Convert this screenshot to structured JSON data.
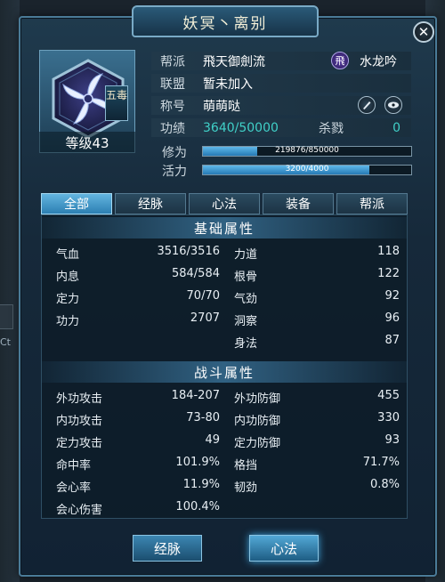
{
  "window": {
    "title": "妖冥丶离别"
  },
  "profile": {
    "school_badge": "五毒",
    "level_text": "等级43",
    "rows": [
      {
        "label": "帮派",
        "value": "飛天御劍流",
        "extra_icon": "飛",
        "extra_value": "水龙吟"
      },
      {
        "label": "联盟",
        "value": "暂未加入"
      },
      {
        "label": "称号",
        "value": "萌萌哒"
      },
      {
        "label": "功绩",
        "value": "3640/50000",
        "label2": "杀戮",
        "value2": "0"
      }
    ],
    "bars": [
      {
        "label": "修为",
        "text": "219876/850000",
        "progress": 0.259
      },
      {
        "label": "活力",
        "text": "3200/4000",
        "progress": 0.8
      }
    ]
  },
  "tabs": [
    {
      "label": "全部",
      "active": true
    },
    {
      "label": "经脉",
      "active": false
    },
    {
      "label": "心法",
      "active": false
    },
    {
      "label": "装备",
      "active": false
    },
    {
      "label": "帮派",
      "active": false
    }
  ],
  "basic": {
    "title": "基础属性",
    "left": [
      {
        "name": "气血",
        "value": "3516/3516"
      },
      {
        "name": "内息",
        "value": "584/584"
      },
      {
        "name": "定力",
        "value": "70/70"
      },
      {
        "name": "功力",
        "value": "2707"
      }
    ],
    "right": [
      {
        "name": "力道",
        "value": "118"
      },
      {
        "name": "根骨",
        "value": "122"
      },
      {
        "name": "气劲",
        "value": "92"
      },
      {
        "name": "洞察",
        "value": "96"
      },
      {
        "name": "身法",
        "value": "87"
      }
    ]
  },
  "combat": {
    "title": "战斗属性",
    "left": [
      {
        "name": "外功攻击",
        "value": "184-207"
      },
      {
        "name": "内功攻击",
        "value": "73-80"
      },
      {
        "name": "定力攻击",
        "value": "49"
      },
      {
        "name": "命中率",
        "value": "101.9%"
      },
      {
        "name": "会心率",
        "value": "11.9%"
      },
      {
        "name": "会心伤害",
        "value": "100.4%"
      }
    ],
    "right": [
      {
        "name": "外功防御",
        "value": "455"
      },
      {
        "name": "内功防御",
        "value": "330"
      },
      {
        "name": "定力防御",
        "value": "93"
      },
      {
        "name": "格挡",
        "value": "71.7%"
      },
      {
        "name": "韧劲",
        "value": "0.8%"
      }
    ]
  },
  "buttons": {
    "left": "经脉",
    "right": "心法"
  },
  "background": {
    "ghost_text": "Ct"
  },
  "colors": {
    "accent": "#2c7fb2",
    "accent_light": "#63b5e0",
    "merit": "#40d0c8",
    "gold": "#f4f0d8"
  }
}
